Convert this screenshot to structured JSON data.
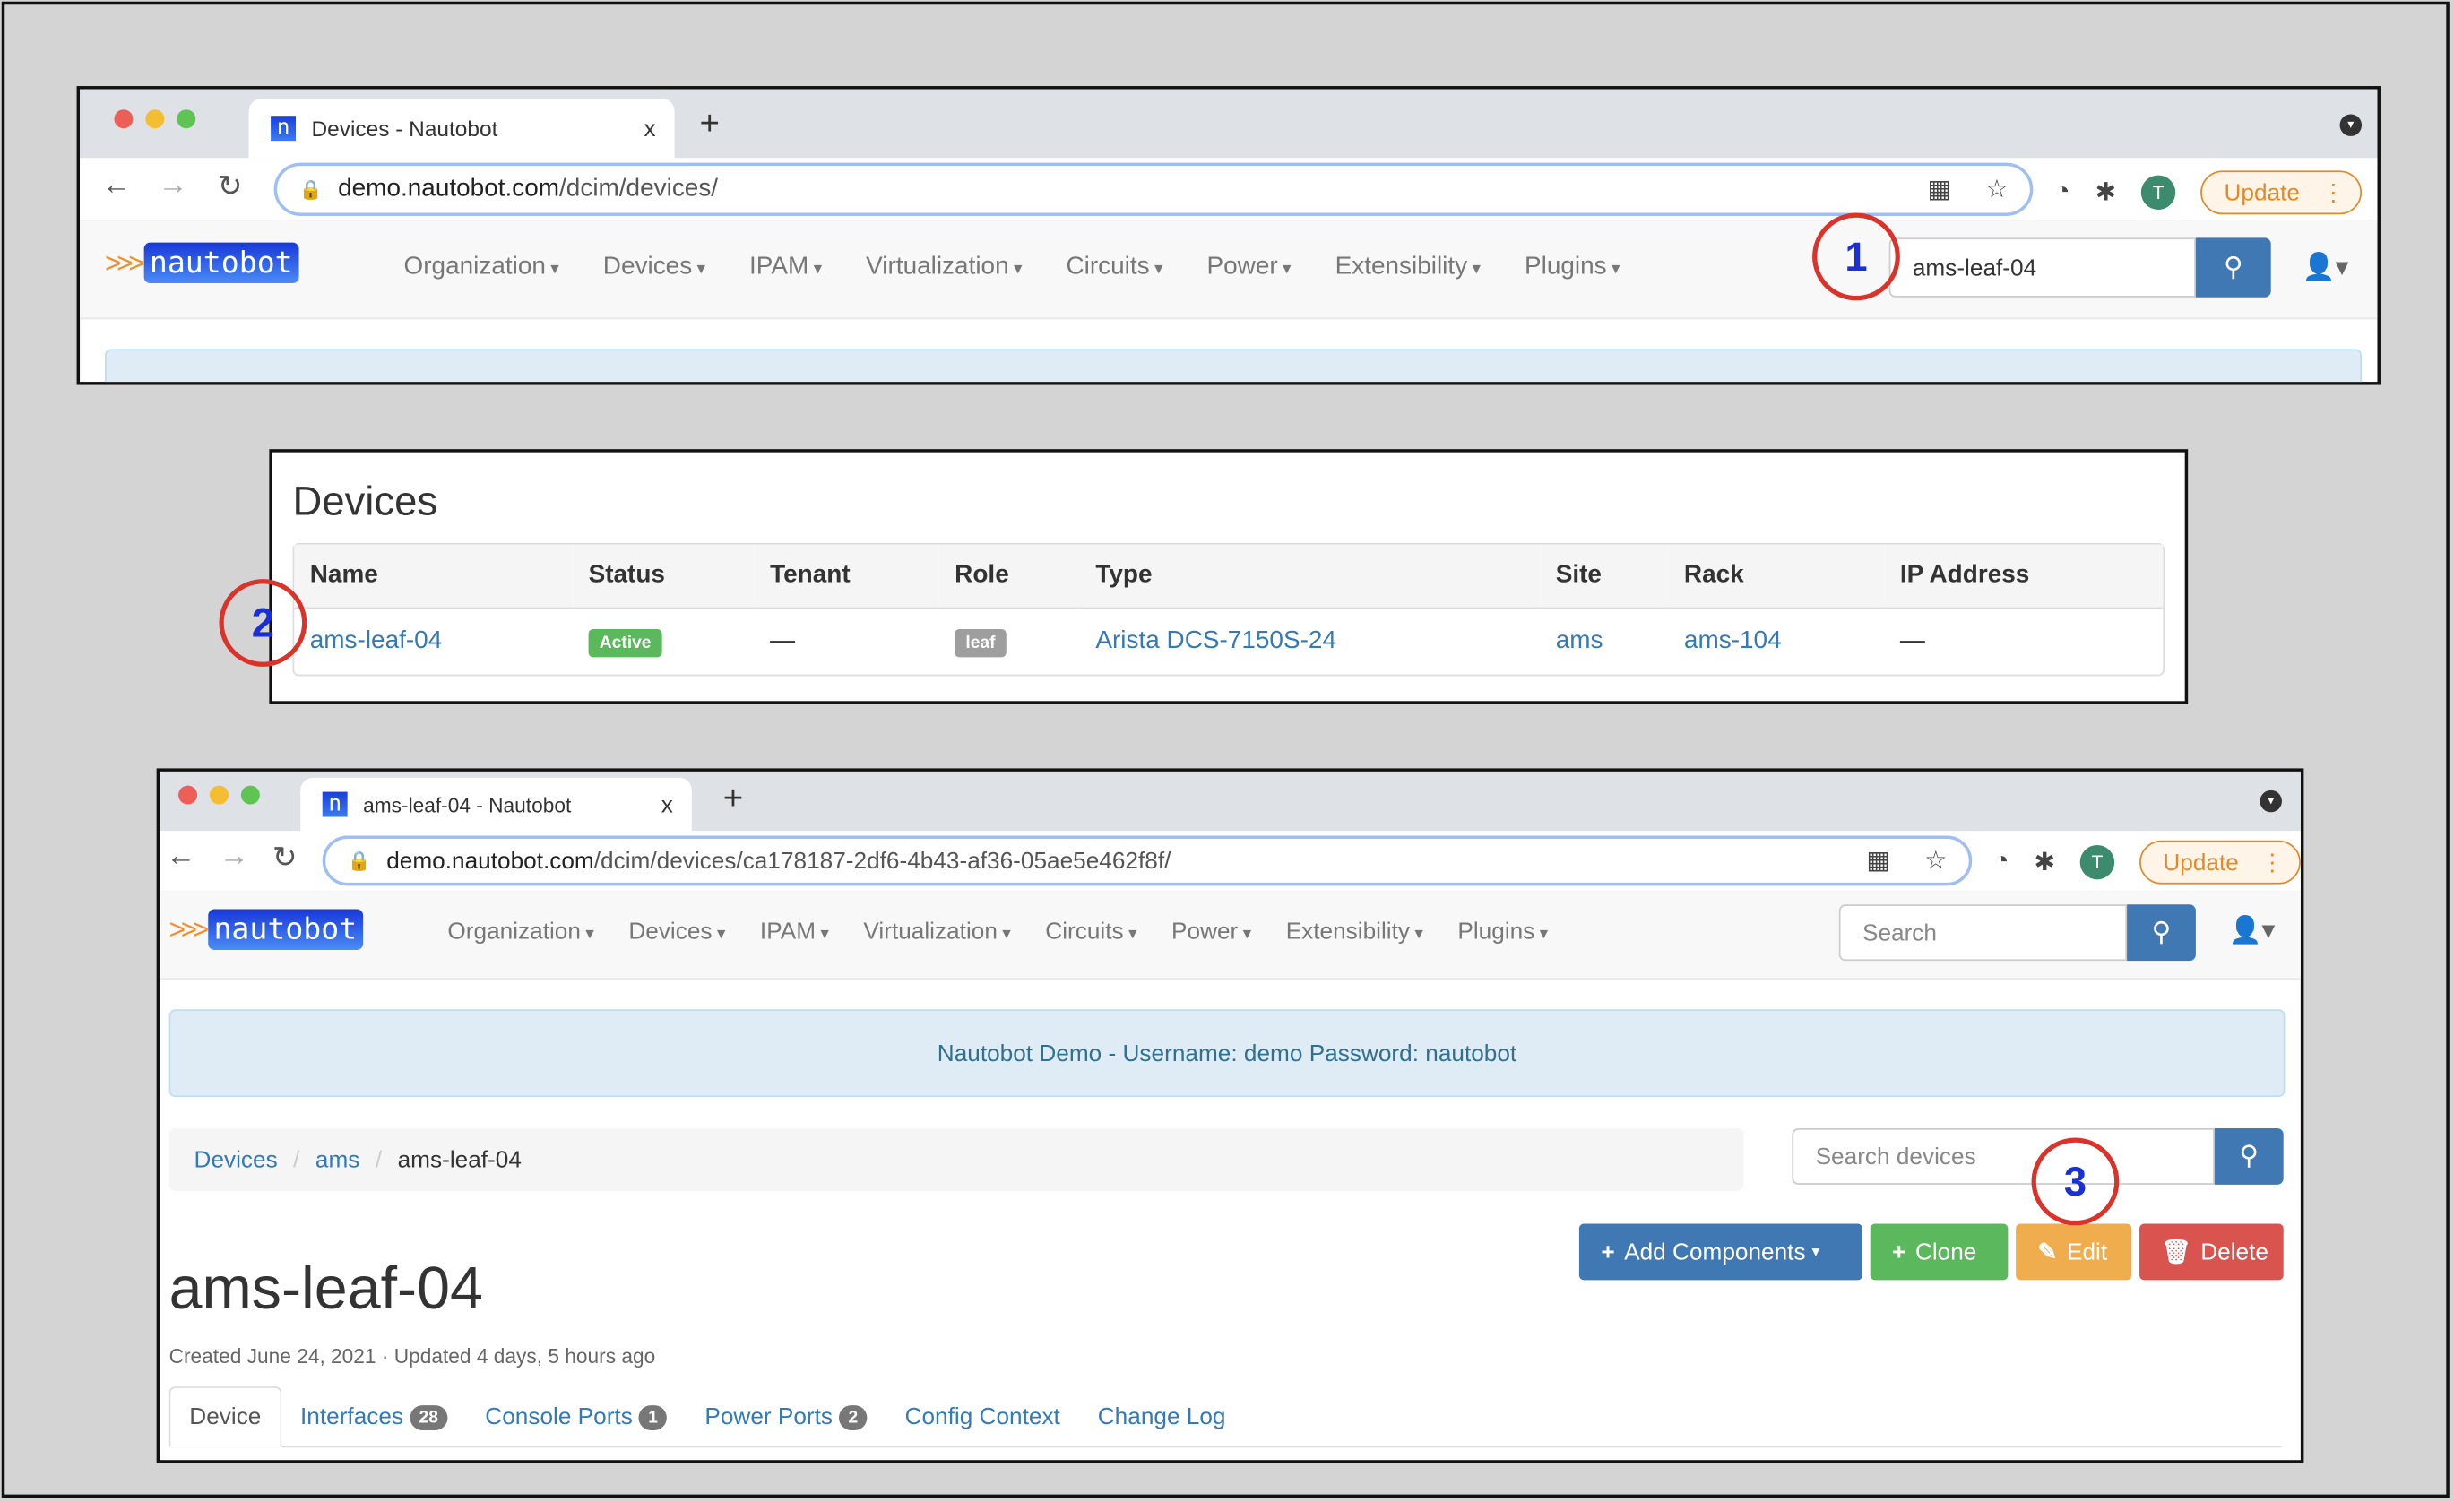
{
  "browser1": {
    "tab_title": "Devices - Nautobot",
    "tab_close": "x",
    "new_tab": "+",
    "url_host": "demo.nautobot.com",
    "url_path": "/dcim/devices/",
    "profile_initial": "T",
    "update_label": "Update"
  },
  "browser2": {
    "tab_title": "ams-leaf-04 - Nautobot",
    "tab_close": "x",
    "new_tab": "+",
    "url_host": "demo.nautobot.com",
    "url_path": "/dcim/devices/ca178187-2df6-4b43-af36-05ae5e462f8f/",
    "profile_initial": "T",
    "update_label": "Update"
  },
  "app": {
    "logo_text": "nautobot",
    "logo_arrows": ">>>",
    "nav": [
      "Organization",
      "Devices",
      "IPAM",
      "Virtualization",
      "Circuits",
      "Power",
      "Extensibility",
      "Plugins"
    ],
    "search_value_step1": "ams-leaf-04",
    "search_placeholder": "Search"
  },
  "callouts": [
    "1",
    "2",
    "3"
  ],
  "device_list": {
    "title": "Devices",
    "columns": [
      "Name",
      "Status",
      "Tenant",
      "Role",
      "Type",
      "Site",
      "Rack",
      "IP Address"
    ],
    "rows": [
      {
        "name": "ams-leaf-04",
        "status": "Active",
        "tenant": "—",
        "role": "leaf",
        "type": "Arista DCS-7150S-24",
        "site": "ams",
        "rack": "ams-104",
        "ip": "—"
      }
    ],
    "status_color": "#5cb85c",
    "role_color": "#9e9e9e"
  },
  "device_detail": {
    "alert": "Nautobot Demo - Username: demo Password: nautobot",
    "breadcrumb": [
      "Devices",
      "ams",
      "ams-leaf-04"
    ],
    "search_devices_placeholder": "Search devices",
    "buttons": {
      "add_components": "Add Components",
      "clone": "Clone",
      "edit": "Edit",
      "delete": "Delete"
    },
    "button_colors": {
      "add_components": "#4078b4",
      "clone": "#5cb85c",
      "edit": "#f0ad4e",
      "delete": "#d9534f"
    },
    "title": "ams-leaf-04",
    "meta": "Created June 24, 2021 · Updated 4 days, 5 hours ago",
    "tabs": [
      {
        "label": "Device",
        "badge": null
      },
      {
        "label": "Interfaces",
        "badge": "28"
      },
      {
        "label": "Console Ports",
        "badge": "1"
      },
      {
        "label": "Power Ports",
        "badge": "2"
      },
      {
        "label": "Config Context",
        "badge": null
      },
      {
        "label": "Change Log",
        "badge": null
      }
    ]
  }
}
